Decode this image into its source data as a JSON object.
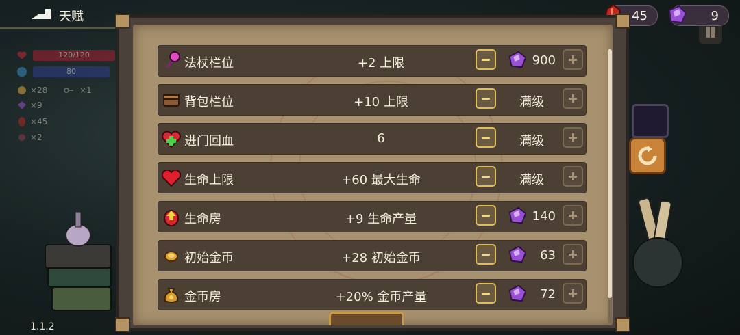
{
  "header": {
    "title": "天赋",
    "back_icon": "back-arrow-icon"
  },
  "currencies": {
    "soul": {
      "icon": "red-crystal-icon",
      "value": "45",
      "color": "#c0281e"
    },
    "gem": {
      "icon": "purple-gem-icon",
      "value": "9",
      "color": "#9b4fd6"
    }
  },
  "hud": {
    "hp": "120/120",
    "mp": "80",
    "coins": "×28",
    "keys": "×1",
    "gems": "×9",
    "crystals": "×45",
    "misc": "×2"
  },
  "version": "1.1.2",
  "talents": [
    {
      "icon": "magic-wand-icon",
      "name": "法杖栏位",
      "effect": "+2 上限",
      "cost": "900",
      "maxed": false
    },
    {
      "icon": "backpack-icon",
      "name": "背包栏位",
      "effect": "+10 上限",
      "cost": "满级",
      "maxed": true
    },
    {
      "icon": "heart-plus-icon",
      "name": "进门回血",
      "effect": "6",
      "cost": "满级",
      "maxed": true
    },
    {
      "icon": "heart-icon",
      "name": "生命上限",
      "effect": "+60 最大生命",
      "cost": "满级",
      "maxed": true
    },
    {
      "icon": "life-room-icon",
      "name": "生命房",
      "effect": "+9 生命产量",
      "cost": "140",
      "maxed": false
    },
    {
      "icon": "coin-icon",
      "name": "初始金币",
      "effect": "+28 初始金币",
      "cost": "63",
      "maxed": false
    },
    {
      "icon": "money-bag-icon",
      "name": "金币房",
      "effect": "+20% 金币产量",
      "cost": "72",
      "maxed": false
    }
  ],
  "colors": {
    "panel_bg": "#a8916f",
    "row_bg": "#4c4035",
    "accent_gold": "#e2bd55"
  }
}
